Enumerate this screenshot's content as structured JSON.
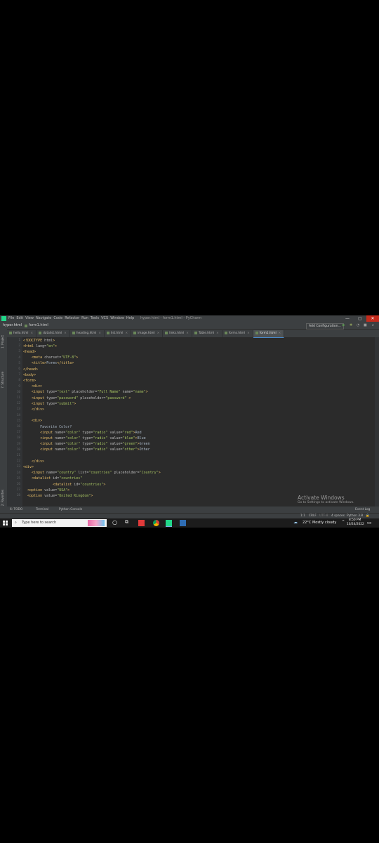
{
  "window": {
    "menu": [
      "File",
      "Edit",
      "View",
      "Navigate",
      "Code",
      "Refactor",
      "Run",
      "Tools",
      "VCS",
      "Window",
      "Help"
    ],
    "title": "hyper.html - form1.html - PyCharm",
    "controls": {
      "minimize": "—",
      "maximize": "▢",
      "close": "✕"
    }
  },
  "navbar": {
    "project": "hyper.html",
    "file": "form1.html",
    "add_config": "Add Configuration..."
  },
  "tabs": [
    {
      "label": "hello.html",
      "active": false
    },
    {
      "label": "datalist.html",
      "active": false
    },
    {
      "label": "heading.html",
      "active": false
    },
    {
      "label": "list.html",
      "active": false
    },
    {
      "label": "image.html",
      "active": false
    },
    {
      "label": "links.html",
      "active": false
    },
    {
      "label": "Table.html",
      "active": false
    },
    {
      "label": "forms.html",
      "active": false
    },
    {
      "label": "form1.html",
      "active": true
    }
  ],
  "side_panels": {
    "project": "1: Project",
    "structure": "7: Structure",
    "favorites": "2: Favorites"
  },
  "code_lines": [
    "<!DOCTYPE html>",
    "<html lang=\"en\">",
    "<head>",
    "    <meta charset=\"UTF-8\">",
    "    <title>Forms</title>",
    "</head>",
    "<body>",
    "<form>",
    "    <div>",
    "    <input type=\"text\" placeholder=\"Full Name\" name=\"name\">",
    "    <input type=\"password\" placeholder=\"password\" >",
    "    <input type=\"submit\">",
    "    </div>",
    "",
    "    <div>",
    "        Favorite Color?",
    "        <input name=\"color\" type=\"radio\" value=\"red\">Red",
    "        <input name=\"color\" type=\"radio\" value=\"blue\">Blue",
    "        <input name=\"color\" type=\"radio\" value=\"green\">Green",
    "        <input name=\"color\" type=\"radio\" value=\"other\">Other",
    "",
    "    </div>",
    "<div>",
    "    <input name=\"country\" list=\"countries\" placeholder=\"Country\">",
    "    <datalist id=\"countries\"",
    "              <datalist id=\"countries\">",
    "  <option value=\"USA\">",
    "  <option value=\"United Kingdom\">"
  ],
  "activate": {
    "title": "Activate Windows",
    "subtitle": "Go to Settings to activate Windows."
  },
  "toolbar": {
    "todo": "6: TODO",
    "terminal": "Terminal",
    "python_console": "Python Console",
    "event_log": "Event Log"
  },
  "status": {
    "position": "1:1",
    "line_sep": "CRLF",
    "encoding": "UTF-8",
    "indent": "4 spaces",
    "interpreter": "Python 3.8"
  },
  "taskbar": {
    "search_placeholder": "Type here to search",
    "weather": "22°C  Mostly cloudy",
    "time": "8:50 PM",
    "date": "10/24/2022"
  }
}
